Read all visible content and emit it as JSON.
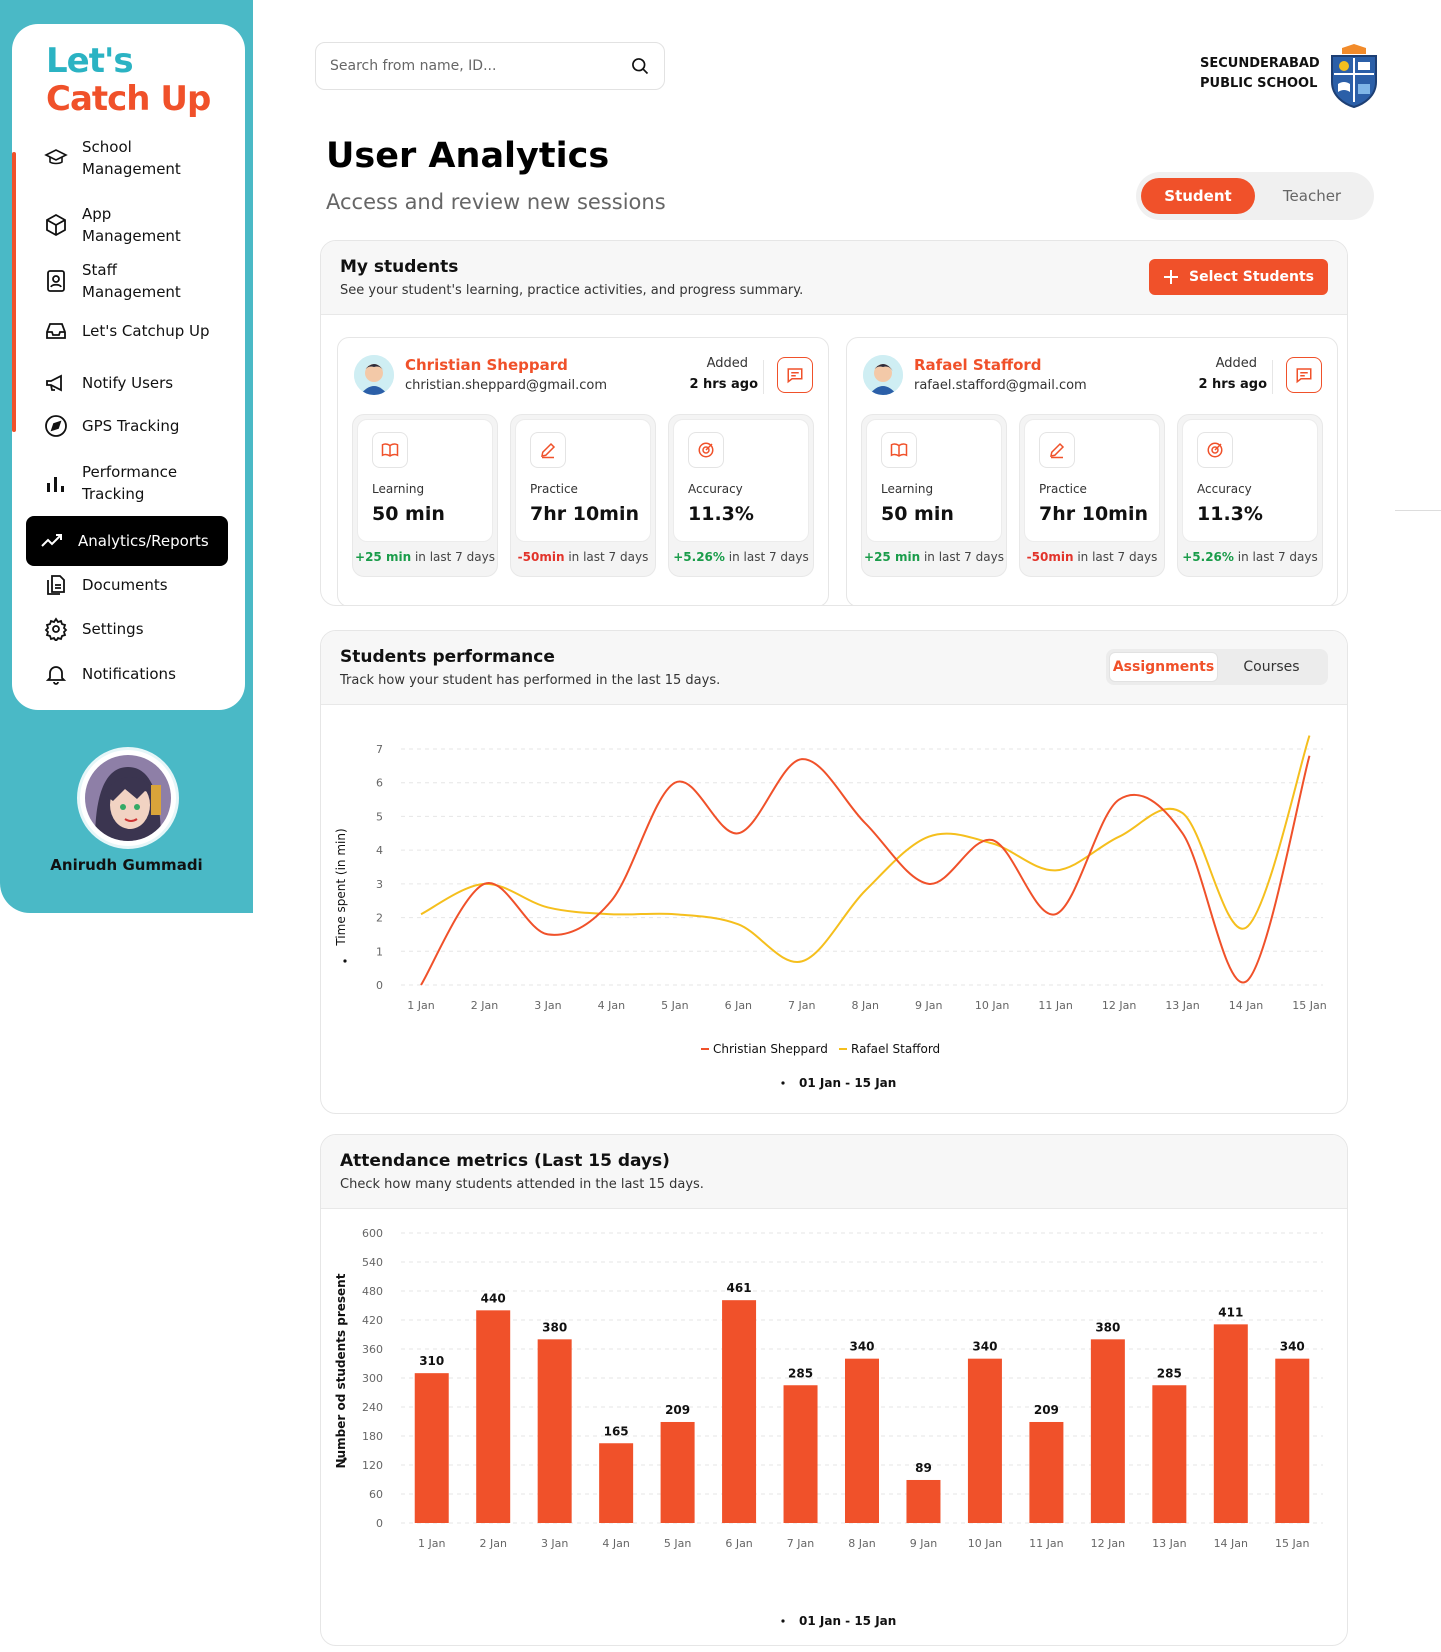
{
  "brand": {
    "line1": "Let's",
    "line2": "Catch Up"
  },
  "sidebar": {
    "items": [
      {
        "label1": "School",
        "label2": "Management",
        "icon": "graduation-cap-icon"
      },
      {
        "label1": "App",
        "label2": "Management",
        "icon": "cube-icon"
      },
      {
        "label1": "Staff",
        "label2": "Management",
        "icon": "staff-badge-icon"
      },
      {
        "label1": "Let's Catchup Up",
        "icon": "inbox-icon"
      },
      {
        "label1": "Notify Users",
        "icon": "megaphone-icon"
      },
      {
        "label1": "GPS Tracking",
        "icon": "navigation-icon"
      },
      {
        "label1": "Performance",
        "label2": "Tracking",
        "icon": "bar-chart-icon"
      },
      {
        "label1": "Analytics/Reports",
        "icon": "trend-icon",
        "active": true
      },
      {
        "label1": "Documents",
        "icon": "documents-icon"
      },
      {
        "label1": "Settings",
        "icon": "gear-icon"
      },
      {
        "label1": "Notifications",
        "icon": "bell-icon"
      }
    ],
    "user_name": "Anirudh Gummadi"
  },
  "search": {
    "placeholder": "Search from name, ID..."
  },
  "school": {
    "line1": "SECUNDERABAD",
    "line2": "PUBLIC SCHOOL"
  },
  "page": {
    "title": "User Analytics",
    "subtitle": "Access and review new sessions"
  },
  "role_toggle": {
    "options": [
      "Student",
      "Teacher"
    ],
    "selected": "Student"
  },
  "my_students": {
    "title": "My students",
    "subtitle": "See your student's learning, practice activities, and progress summary.",
    "select_button": "Select Students",
    "students": [
      {
        "name": "Christian Sheppard",
        "email": "christian.sheppard@gmail.com",
        "added_label": "Added",
        "added_ago": "2 hrs ago",
        "metrics": [
          {
            "label": "Learning",
            "value": "50 min",
            "delta": "+25 min",
            "period": "in last 7 days",
            "icon": "book-icon"
          },
          {
            "label": "Practice",
            "value": "7hr 10min",
            "delta": "-50min",
            "period": "in last 7 days",
            "icon": "pencil-icon"
          },
          {
            "label": "Accuracy",
            "value": "11.3%",
            "delta": "+5.26%",
            "period": "in last 7 days",
            "icon": "target-icon"
          }
        ]
      },
      {
        "name": "Rafael Stafford",
        "email": "rafael.stafford@gmail.com",
        "added_label": "Added",
        "added_ago": "2 hrs ago",
        "metrics": [
          {
            "label": "Learning",
            "value": "50 min",
            "delta": "+25 min",
            "period": "in last 7 days",
            "icon": "book-icon"
          },
          {
            "label": "Practice",
            "value": "7hr 10min",
            "delta": "-50min",
            "period": "in last 7 days",
            "icon": "pencil-icon"
          },
          {
            "label": "Accuracy",
            "value": "11.3%",
            "delta": "+5.26%",
            "period": "in last 7 days",
            "icon": "target-icon"
          }
        ]
      }
    ]
  },
  "performance": {
    "title": "Students performance",
    "subtitle": "Track how your student  has performed in the last 15 days.",
    "tabs": [
      "Assignments",
      "Courses"
    ],
    "selected_tab": "Assignments",
    "range": "01 Jan - 15 Jan"
  },
  "attendance": {
    "title": "Attendance metrics (Last 15 days)",
    "subtitle": "Check how many students attended in the last 15 days.",
    "range": "01 Jan - 15 Jan"
  },
  "colors": {
    "accent": "#f0512a",
    "teal": "#4ab9c6",
    "series2": "#f5bf1d"
  },
  "chart_data": [
    {
      "type": "line",
      "ylabel": "Time spent (in min)",
      "xlabel": "",
      "categories": [
        "1 Jan",
        "2 Jan",
        "3 Jan",
        "4 Jan",
        "5 Jan",
        "6 Jan",
        "7 Jan",
        "8 Jan",
        "9 Jan",
        "10 Jan",
        "11 Jan",
        "12 Jan",
        "13 Jan",
        "14 Jan",
        "15 Jan"
      ],
      "yticks": [
        "0",
        "1",
        "2",
        "3",
        "4",
        "5",
        "6",
        "7"
      ],
      "ylim": [
        0,
        7
      ],
      "series": [
        {
          "name": "Christian Sheppard",
          "values": [
            0,
            3,
            1.5,
            2.5,
            6,
            4.5,
            6.7,
            4.8,
            3,
            4.3,
            2.1,
            5.5,
            4.5,
            0.1,
            6.8
          ]
        },
        {
          "name": "Rafael Stafford",
          "values": [
            2.1,
            3,
            2.3,
            2.1,
            2.1,
            1.8,
            0.7,
            2.8,
            4.4,
            4.2,
            3.4,
            4.4,
            5.1,
            1.7,
            7.4
          ]
        }
      ],
      "legend": "bottom-center",
      "grid": true
    },
    {
      "type": "bar",
      "ylabel": "Number od students present",
      "xlabel": "",
      "categories": [
        "1 Jan",
        "2 Jan",
        "3 Jan",
        "4 Jan",
        "5 Jan",
        "6 Jan",
        "7 Jan",
        "8 Jan",
        "9 Jan",
        "10 Jan",
        "11 Jan",
        "12 Jan",
        "13 Jan",
        "14 Jan",
        "15 Jan"
      ],
      "values": [
        310,
        440,
        380,
        165,
        209,
        461,
        285,
        340,
        89,
        340,
        209,
        380,
        285,
        411,
        340
      ],
      "yticks": [
        "600",
        "540",
        "480",
        "420",
        "360",
        "300",
        "240",
        "180",
        "120",
        "60",
        "0"
      ],
      "ylim": [
        0,
        600
      ],
      "grid": true
    }
  ]
}
